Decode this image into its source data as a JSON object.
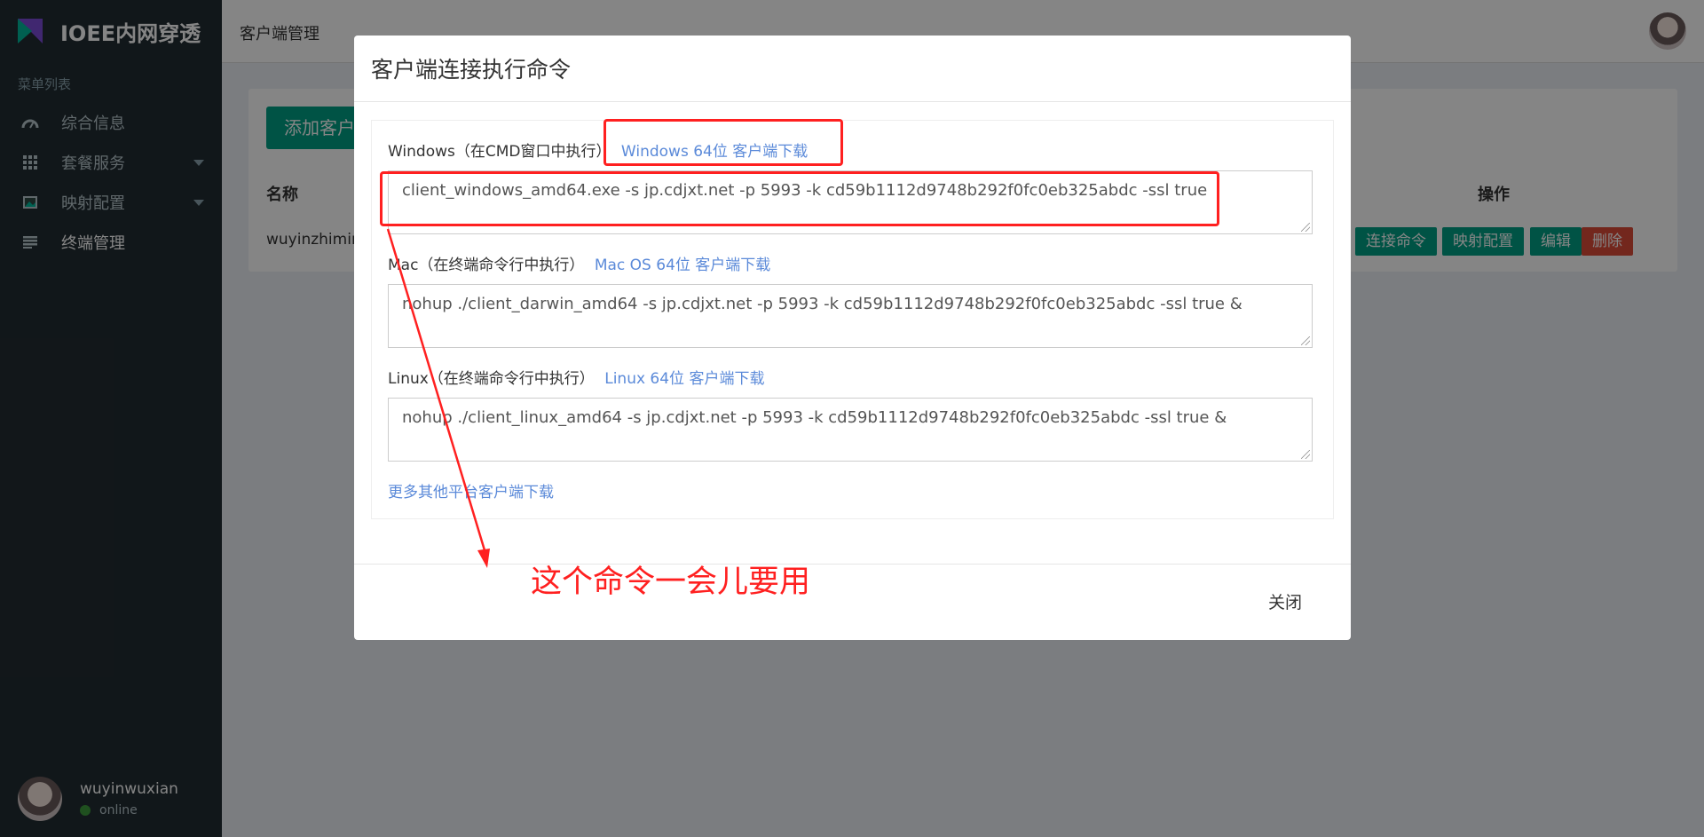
{
  "brand": {
    "name": "IOEE内网穿透"
  },
  "sidebar": {
    "menu_title": "菜单列表",
    "items": [
      {
        "label": "综合信息",
        "icon": "dashboard-gauge-icon"
      },
      {
        "label": "套餐服务",
        "icon": "grid-icon"
      },
      {
        "label": "映射配置",
        "icon": "image-icon"
      },
      {
        "label": "终端管理",
        "icon": "list-icon"
      }
    ],
    "user": {
      "name": "wuyinwuxian",
      "status": "online"
    }
  },
  "header": {
    "title": "客户端管理"
  },
  "content": {
    "add_button": "添加客户端",
    "col_name": "名称",
    "col_ops": "操作",
    "row_name": "wuyinzhimin",
    "ops": [
      "连接命令",
      "映射配置",
      "编辑",
      "删除"
    ]
  },
  "modal": {
    "title": "客户端连接执行命令",
    "windows": {
      "label": "Windows（在CMD窗口中执行）",
      "link": "Windows 64位 客户端下载",
      "command": "client_windows_amd64.exe -s jp.cdjxt.net -p 5993 -k cd59b1112d9748b292f0fc0eb325abdc -ssl true"
    },
    "mac": {
      "label": "Mac（在终端命令行中执行）",
      "link": "Mac OS 64位 客户端下载",
      "command": "nohup ./client_darwin_amd64 -s jp.cdjxt.net -p 5993 -k cd59b1112d9748b292f0fc0eb325abdc -ssl true &"
    },
    "linux": {
      "label": "Linux（在终端命令行中执行）",
      "link": "Linux 64位 客户端下载",
      "command": "nohup ./client_linux_amd64 -s jp.cdjxt.net -p 5993 -k cd59b1112d9748b292f0fc0eb325abdc -ssl true &"
    },
    "more_link": "更多其他平台客户端下载",
    "close": "关闭"
  },
  "annotation": {
    "text": "这个命令一会儿要用",
    "color": "#ff2020"
  },
  "colors": {
    "sidebar": "#222d32",
    "accent": "#00a085",
    "danger": "#dd4b39",
    "link": "#5b8ad9"
  }
}
